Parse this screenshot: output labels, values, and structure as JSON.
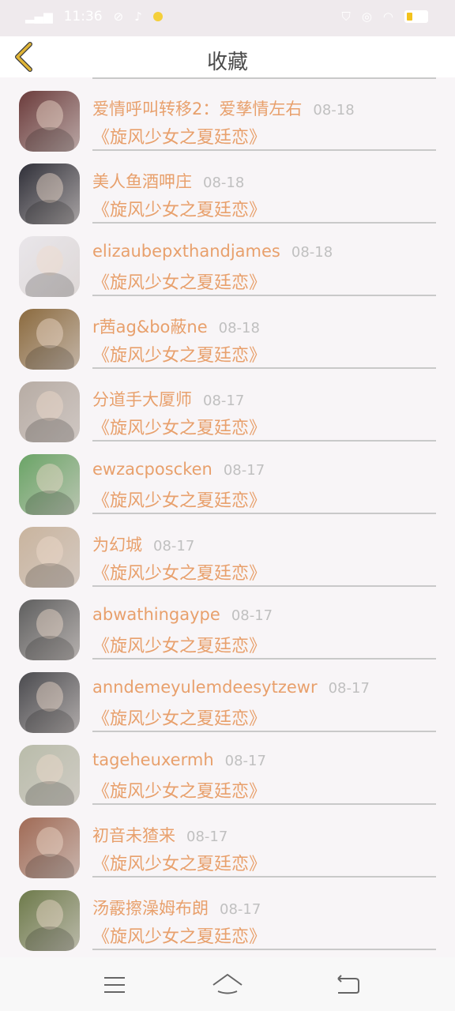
{
  "status": {
    "time": "11:36"
  },
  "header": {
    "title": "收藏"
  },
  "items": [
    {
      "name": "爱情呼叫转移2：爱孳情左右",
      "date": "08-18",
      "title": "《旋风少女之夏廷恋》",
      "avatar_color": "#6b3b3b"
    },
    {
      "name": "美人鱼酒呷庄",
      "date": "08-18",
      "title": "《旋风少女之夏廷恋》",
      "avatar_color": "#2f2f38"
    },
    {
      "name": "elizaubepxthandjames",
      "date": "08-18",
      "title": "《旋风少女之夏廷恋》",
      "avatar_color": "#e9e6ea"
    },
    {
      "name": "r茜ag&bo蔽ne",
      "date": "08-18",
      "title": "《旋风少女之夏廷恋》",
      "avatar_color": "#8b6a3e"
    },
    {
      "name": "分道手大厦师",
      "date": "08-17",
      "title": "《旋风少女之夏廷恋》",
      "avatar_color": "#b7aca4"
    },
    {
      "name": "ewzacposcken",
      "date": "08-17",
      "title": "《旋风少女之夏廷恋》",
      "avatar_color": "#6aa466"
    },
    {
      "name": "为幻城",
      "date": "08-17",
      "title": "《旋风少女之夏廷恋》",
      "avatar_color": "#c9b49e"
    },
    {
      "name": "abwathingaype",
      "date": "08-17",
      "title": "《旋风少女之夏廷恋》",
      "avatar_color": "#5e5e5e"
    },
    {
      "name": "anndemeyulemdeesytzewr",
      "date": "08-17",
      "title": "《旋风少女之夏廷恋》",
      "avatar_color": "#4a4a4e"
    },
    {
      "name": "tageheuxermh",
      "date": "08-17",
      "title": "《旋风少女之夏廷恋》",
      "avatar_color": "#b9bcaa"
    },
    {
      "name": "初音未猹来",
      "date": "08-17",
      "title": "《旋风少女之夏廷恋》",
      "avatar_color": "#a06a55"
    },
    {
      "name": "汤霰擦澡姆布朗",
      "date": "08-17",
      "title": "《旋风少女之夏廷恋》",
      "avatar_color": "#6d7a4a"
    }
  ],
  "icons": {
    "back": "chevron-left-icon",
    "menu": "menu-icon",
    "home": "home-icon",
    "return": "return-icon"
  },
  "colors": {
    "accent_text": "#e8a06c",
    "date_text": "#c0c0c0",
    "back_arrow": "#e0b536",
    "page_background": "#f8f5f7"
  }
}
